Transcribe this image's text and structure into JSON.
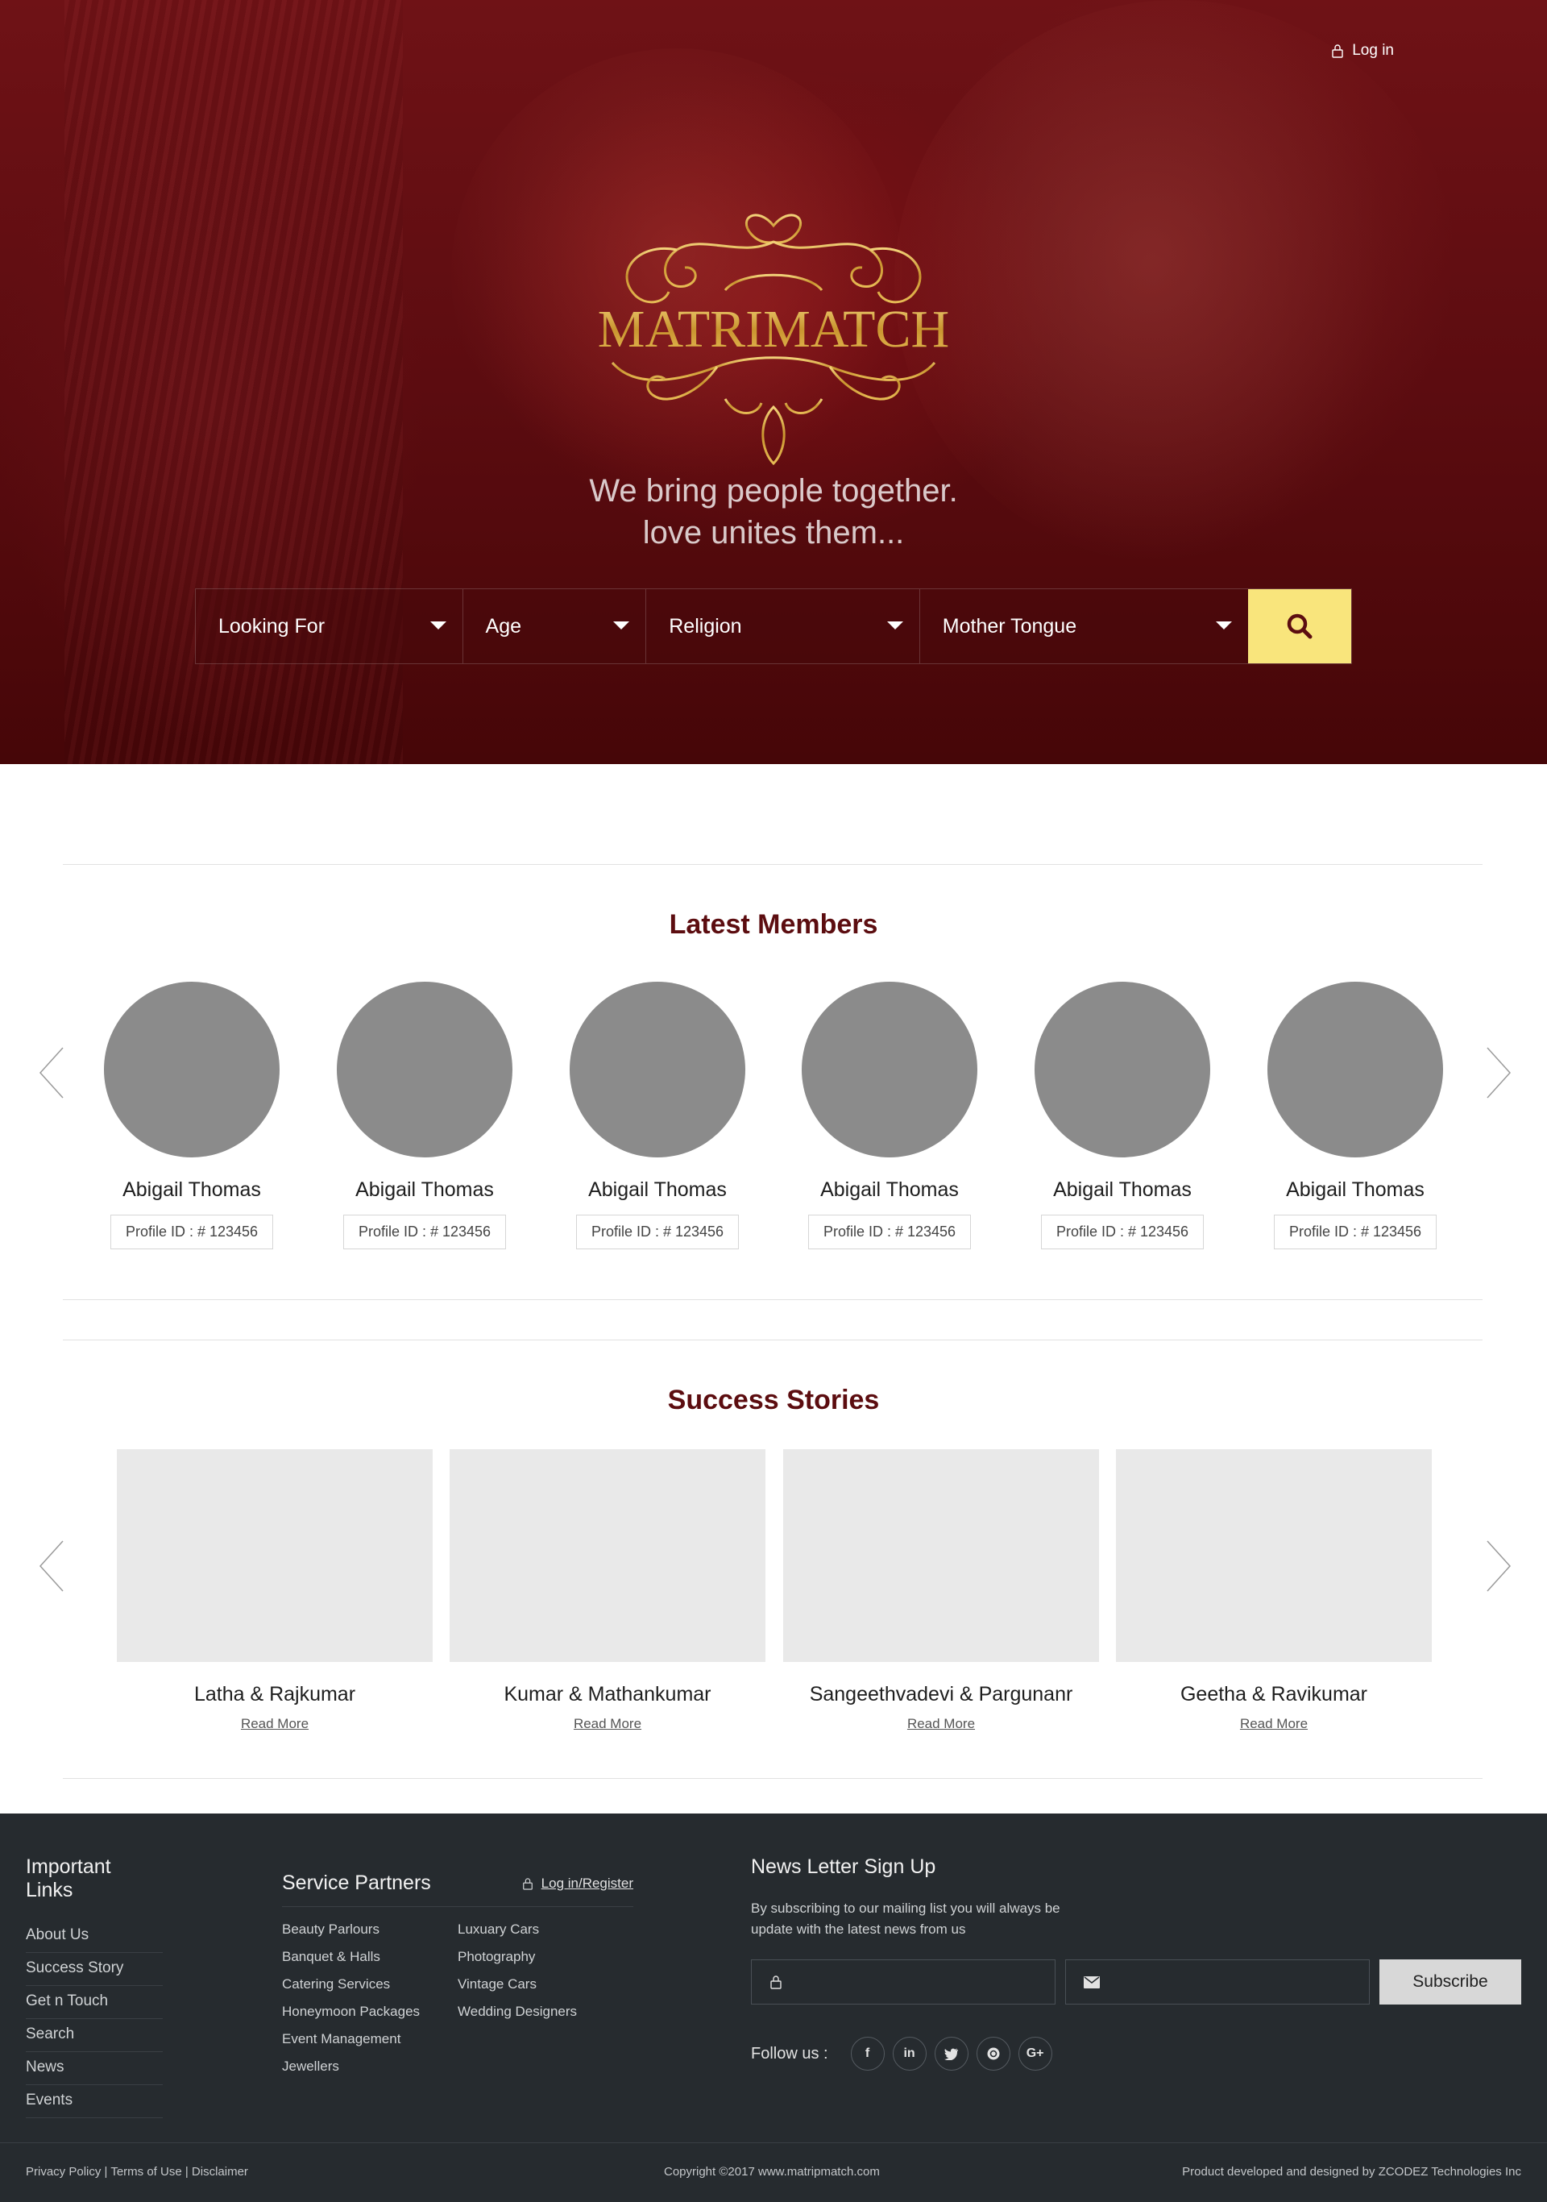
{
  "header": {
    "login_label": "Log in"
  },
  "brand": {
    "logo_text": "MATRIMATCH"
  },
  "hero": {
    "tagline_line1": "We bring people together.",
    "tagline_line2": "love unites them..."
  },
  "search": {
    "fields": [
      "Looking For",
      "Age",
      "Religion",
      "Mother Tongue"
    ],
    "button_icon": "search-icon",
    "button_color": "#f9e57c"
  },
  "latest_members": {
    "title": "Latest Members",
    "members": [
      {
        "name": "Abigail Thomas",
        "profile_id": "Profile ID : # 123456"
      },
      {
        "name": "Abigail Thomas",
        "profile_id": "Profile ID : # 123456"
      },
      {
        "name": "Abigail Thomas",
        "profile_id": "Profile ID : # 123456"
      },
      {
        "name": "Abigail Thomas",
        "profile_id": "Profile ID : # 123456"
      },
      {
        "name": "Abigail Thomas",
        "profile_id": "Profile ID : # 123456"
      },
      {
        "name": "Abigail Thomas",
        "profile_id": "Profile ID : # 123456"
      }
    ]
  },
  "success_stories": {
    "title": "Success Stories",
    "stories": [
      {
        "names": "Latha & Rajkumar",
        "link": "Read More"
      },
      {
        "names": "Kumar & Mathankumar",
        "link": "Read More"
      },
      {
        "names": "Sangeethvadevi & Pargunanr",
        "link": "Read More"
      },
      {
        "names": "Geetha & Ravikumar",
        "link": "Read More"
      }
    ]
  },
  "footer": {
    "important_links": {
      "heading": "Important Links",
      "items": [
        "About Us",
        "Success Story",
        "Get n Touch",
        "Search",
        "News",
        "Events"
      ]
    },
    "service_partners": {
      "heading": "Service Partners",
      "login_register": "Log in/Register",
      "col1": [
        "Beauty Parlours",
        "Banquet & Halls",
        "Catering Services",
        "Honeymoon Packages",
        "Event Management",
        "Jewellers"
      ],
      "col2": [
        "Luxuary Cars",
        "Photography",
        "Vintage Cars",
        "Wedding Designers"
      ]
    },
    "newsletter": {
      "heading": "News Letter Sign Up",
      "description": "By subscribing to our mailing list you will always be update with the latest news from us",
      "subscribe_label": "Subscribe",
      "follow_label": "Follow us :",
      "social": [
        "f",
        "in",
        "twitter",
        "instagram",
        "G+"
      ]
    },
    "bottom": {
      "legal": "Privacy Policy | Terms of Use | Disclaimer",
      "copyright": "Copyright ©2017 www.matripmatch.com",
      "credit": "Product developed and designed by ZCODEZ Technologies Inc"
    }
  },
  "colors": {
    "brand_maroon": "#5c0d10",
    "gold": "#d4a63a",
    "footer_bg": "#262b2f"
  }
}
